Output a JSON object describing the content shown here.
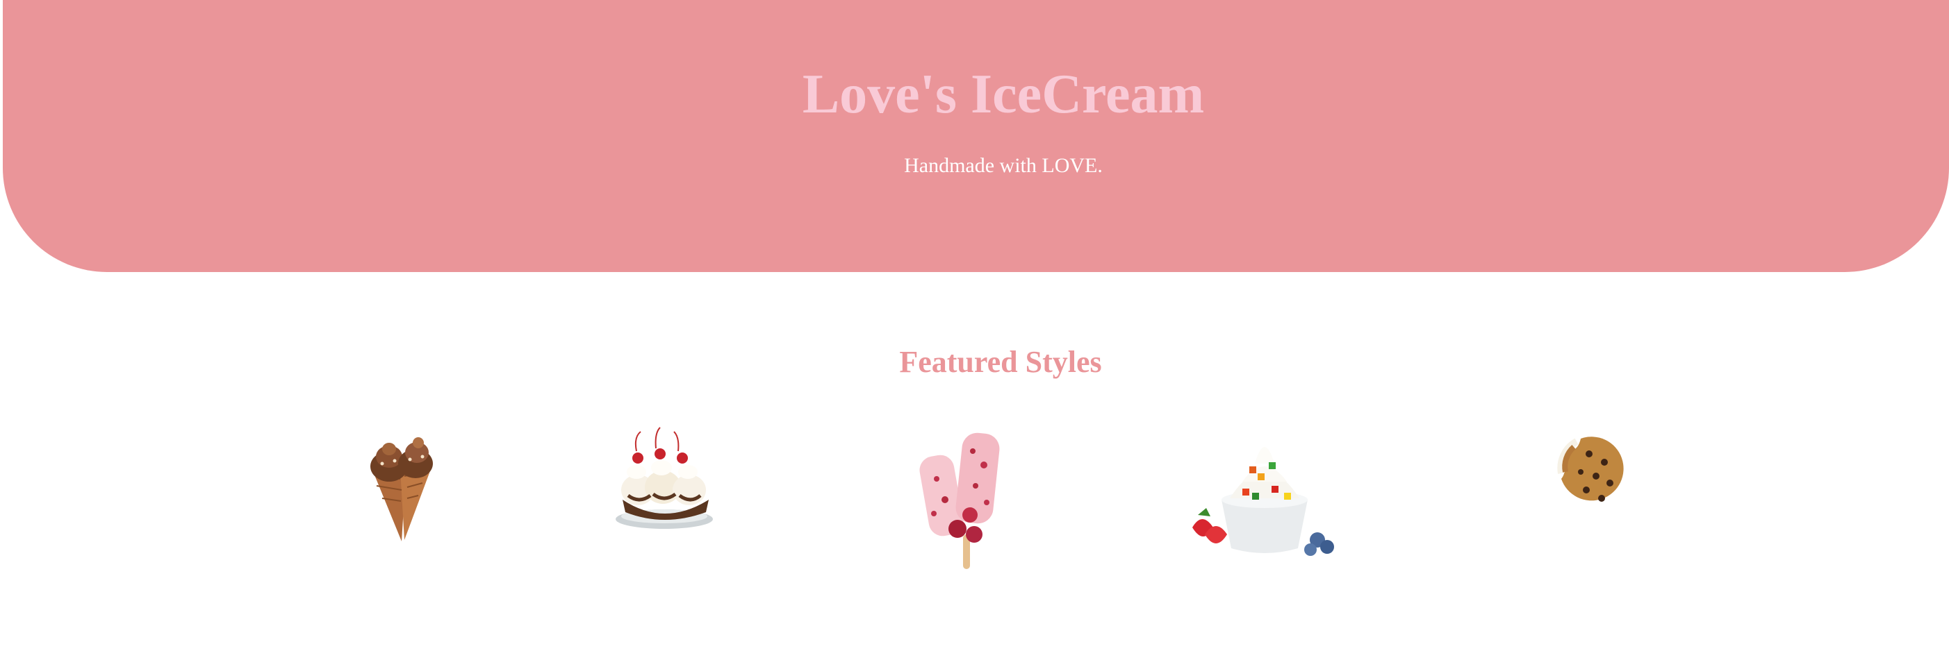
{
  "hero": {
    "title": "Love's IceCream",
    "subtitle": "Handmade with LOVE.",
    "background_color": "#ea9599",
    "title_color": "#f9cad6",
    "subtitle_color": "#ffffff"
  },
  "featured": {
    "title": "Featured Styles",
    "title_color": "#ea9599",
    "items": [
      {
        "icon": "ice-cream-cones-icon"
      },
      {
        "icon": "sundae-icon"
      },
      {
        "icon": "popsicle-icon"
      },
      {
        "icon": "frozen-yogurt-icon"
      },
      {
        "icon": "cookie-sandwich-icon"
      }
    ]
  }
}
